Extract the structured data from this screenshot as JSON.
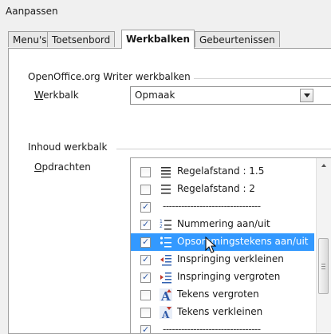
{
  "window": {
    "title": "Aanpassen"
  },
  "tabs": [
    {
      "label": "Menu's"
    },
    {
      "label": "Toetsenbord"
    },
    {
      "label": "Werkbalken"
    },
    {
      "label": "Gebeurtenissen"
    }
  ],
  "toolbars_section": {
    "title": "OpenOffice.org Writer werkbalken",
    "toolbar_label": "Werkbalk",
    "toolbar_value": "Opmaak"
  },
  "contents_section": {
    "title": "Inhoud werkbalk",
    "commands_label": "Opdrachten",
    "items": [
      {
        "label": "Regelafstand : 1.5",
        "checked": false,
        "icon": "line-spacing-icon"
      },
      {
        "label": "Regelafstand : 2",
        "checked": false,
        "icon": "line-spacing-icon"
      },
      {
        "label": "--------------------------------",
        "checked": true,
        "separator": true
      },
      {
        "label": "Nummering aan/uit",
        "checked": true,
        "icon": "numbering-icon"
      },
      {
        "label": "Opsommingstekens aan/uit",
        "checked": true,
        "icon": "bullets-icon",
        "selected": true
      },
      {
        "label": "Inspringing verkleinen",
        "checked": true,
        "icon": "decrease-indent-icon"
      },
      {
        "label": "Inspringing vergroten",
        "checked": true,
        "icon": "increase-indent-icon"
      },
      {
        "label": "Tekens vergroten",
        "checked": false,
        "icon": "grow-font-icon"
      },
      {
        "label": "Tekens verkleinen",
        "checked": false,
        "icon": "shrink-font-icon"
      },
      {
        "label": "--------------------------------",
        "checked": true,
        "separator": true
      }
    ]
  },
  "colors": {
    "selection": "#3399ff",
    "accent": "#2f5aa8"
  }
}
